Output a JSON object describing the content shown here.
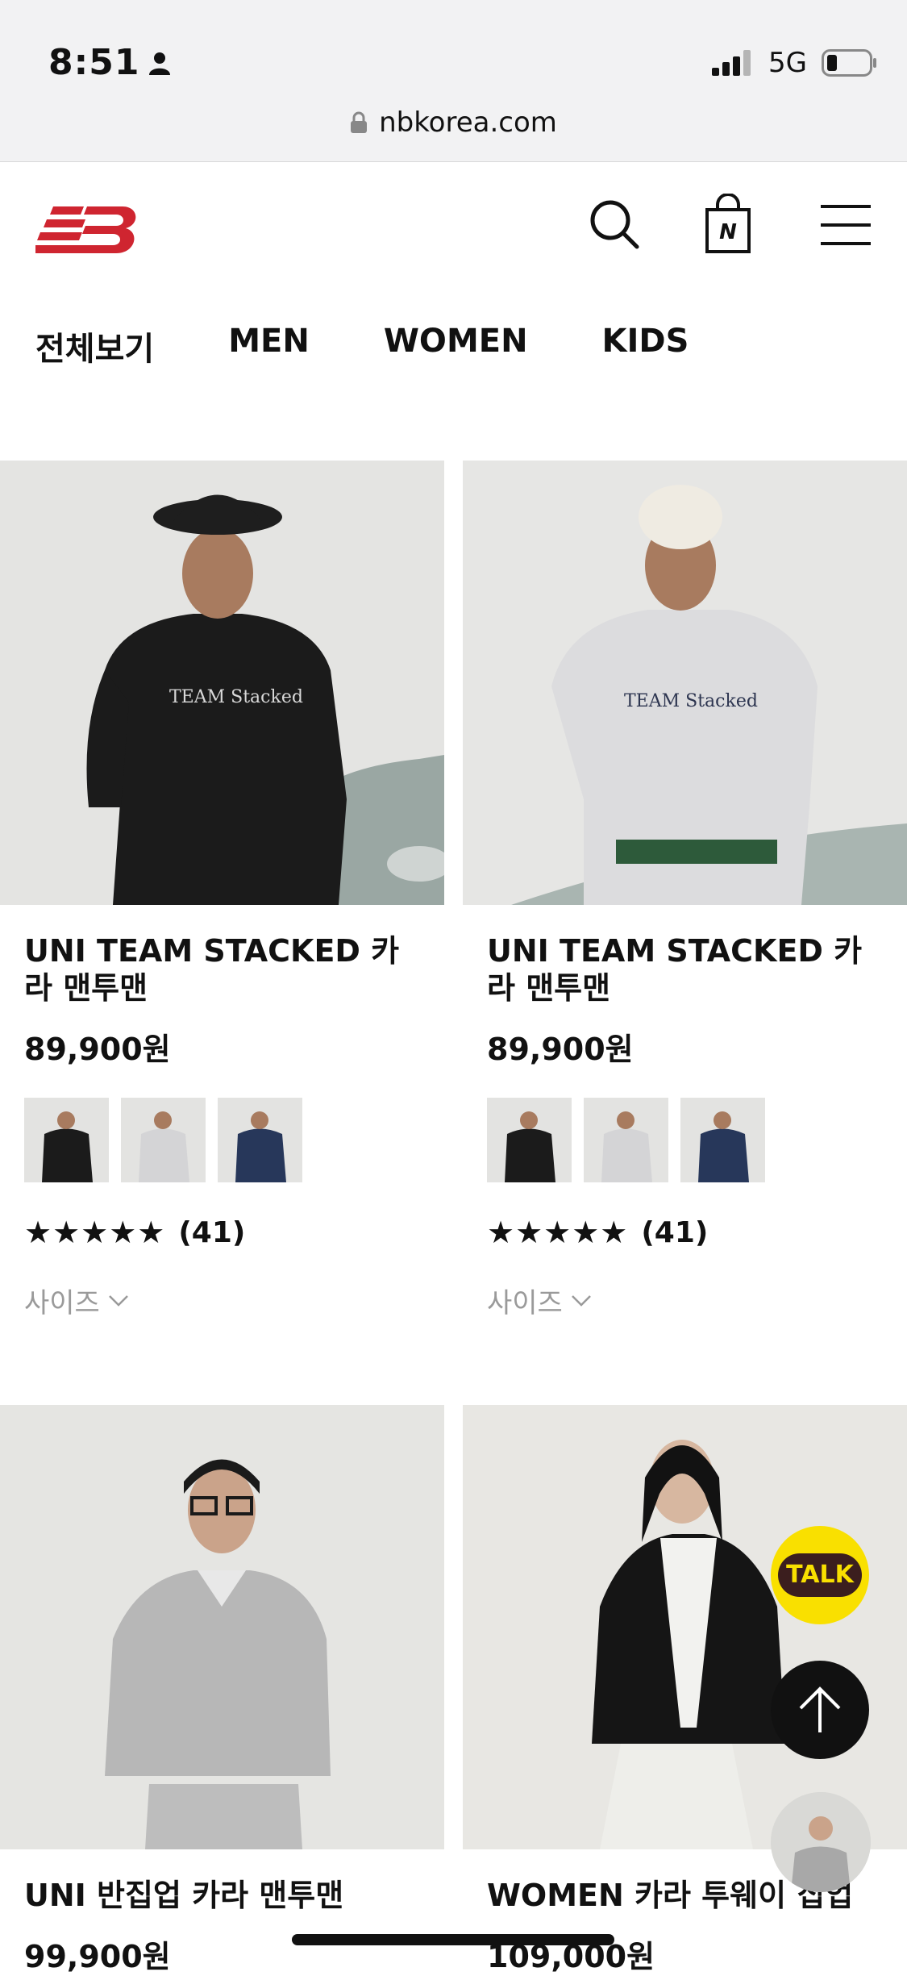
{
  "status_bar": {
    "time": "8:51",
    "network": "5G"
  },
  "browser": {
    "url": "nbkorea.com"
  },
  "nav": {
    "items": [
      "전체보기",
      "MEN",
      "WOMEN",
      "KIDS"
    ]
  },
  "products": [
    {
      "title": "UNI TEAM STACKED 카라 맨투맨",
      "price": "89,900원",
      "rating_stars": 5,
      "review_count": "(41)",
      "size_label": "사이즈"
    },
    {
      "title": "UNI TEAM STACKED 카라 맨투맨",
      "price": "89,900원",
      "rating_stars": 5,
      "review_count": "(41)",
      "size_label": "사이즈"
    },
    {
      "title": "UNI 반집업 카라 맨투맨",
      "price": "99,900원"
    },
    {
      "title": "WOMEN 카라 투웨이 집업",
      "price": "109,000원"
    }
  ],
  "floating": {
    "talk_label": "TALK"
  },
  "colors": {
    "brand_red": "#cf2530",
    "talk_yellow": "#f9e000",
    "talk_brown": "#3b1e1e"
  }
}
